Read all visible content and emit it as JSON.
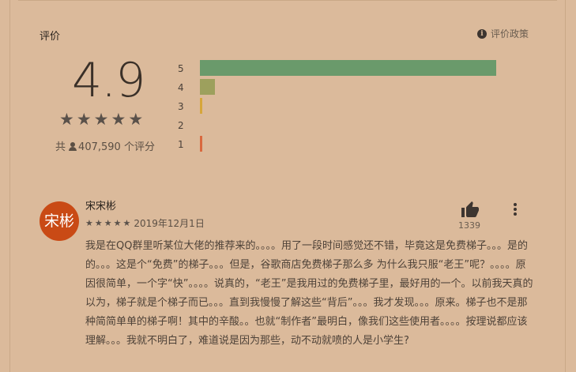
{
  "ratings": {
    "title": "评价",
    "policy_label": "评价政策",
    "average": "4.9",
    "average_stars": 5,
    "total_prefix": "共",
    "total_count": "407,590",
    "total_suffix": "个评分",
    "distribution": [
      {
        "label": "5",
        "fraction": 1.0,
        "color": "#6a9a6b"
      },
      {
        "label": "4",
        "fraction": 0.05,
        "color": "#9da05d"
      },
      {
        "label": "3",
        "fraction": 0.008,
        "color": "#d6a63a"
      },
      {
        "label": "2",
        "fraction": 0.0,
        "color": "#d98a3a"
      },
      {
        "label": "1",
        "fraction": 0.008,
        "color": "#d9693e"
      }
    ]
  },
  "review": {
    "avatar_text": "宋彬",
    "avatar_color": "#c94a15",
    "reviewer": "宋宋彬",
    "stars": 5,
    "date": "2019年12月1日",
    "helpful_count": "1339",
    "text": "我是在QQ群里听某位大佬的推荐来的。。。。用了一段时间感觉还不错，毕竟这是免费梯子。。。是的的。。。这是个“免费”的梯子。。。但是，谷歌商店免费梯子那么多 为什么我只服“老王”呢？。。。。原因很简单，一个字“快”。。。。说真的，“老王”是我用过的免费梯子里，最好用的一个。以前我天真的以为，梯子就是个梯子而已。。。直到我慢慢了解这些“背后”。。。我才发现。。。原来。梯子也不是那种简简单单的梯子啊！其中的辛酸。。也就“制作者”最明白，像我们这些使用者。。。。按理说都应该理解。。。我就不明白了，难道说是因为那些，动不动就喷的人是小学生?"
  }
}
